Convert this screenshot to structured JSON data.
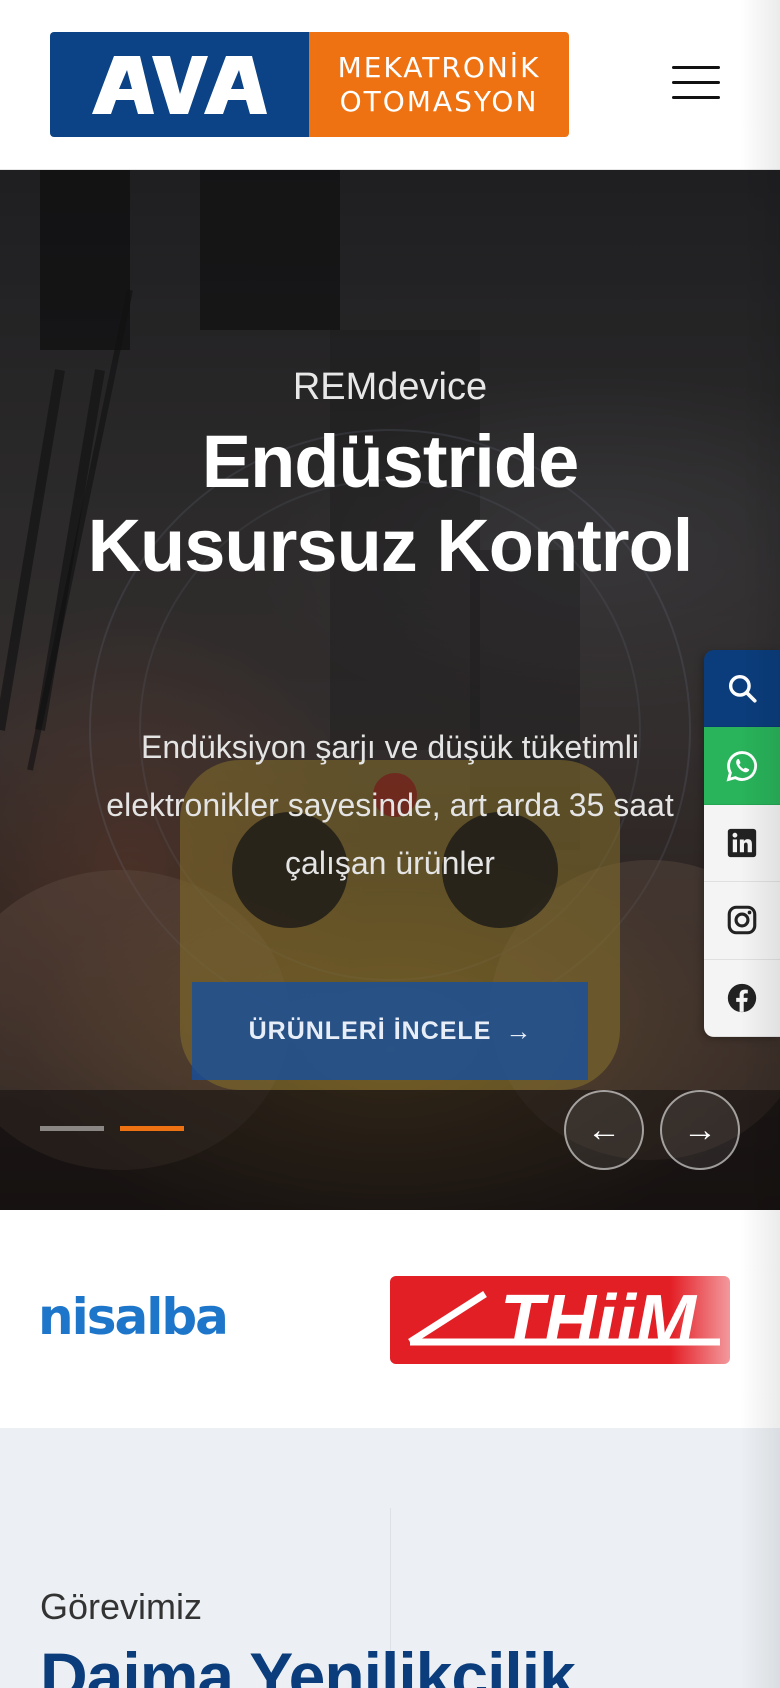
{
  "header": {
    "logo": {
      "mark_text": "AVA",
      "line1": "MEKATRONİK",
      "line2": "OTOMASYON"
    },
    "menu_icon": "hamburger-icon"
  },
  "hero": {
    "eyebrow": "REMdevice",
    "title": "Endüstride Kusursuz Kontrol",
    "description": "Endüksiyon şarjı ve düşük tüketimli elektronikler sayesinde, art arda 35 saat çalışan ürünler",
    "cta_label": "ÜRÜNLERİ İNCELE",
    "cta_icon": "arrow-right-icon",
    "slides": {
      "total": 2,
      "active": 2
    },
    "prev_label": "←",
    "next_label": "→"
  },
  "side_bar": {
    "items": [
      "search-icon",
      "whatsapp-icon",
      "linkedin-icon",
      "instagram-icon",
      "facebook-icon"
    ]
  },
  "brands": {
    "items": [
      "nisalba",
      "THiiM"
    ]
  },
  "mission": {
    "eyebrow": "Görevimiz",
    "title": "Daima Yenilikçilik"
  },
  "colors": {
    "brand_blue": "#0b4386",
    "brand_orange": "#ee7212",
    "whatsapp_green": "#29b35a",
    "heading_blue": "#0b3d7c"
  }
}
